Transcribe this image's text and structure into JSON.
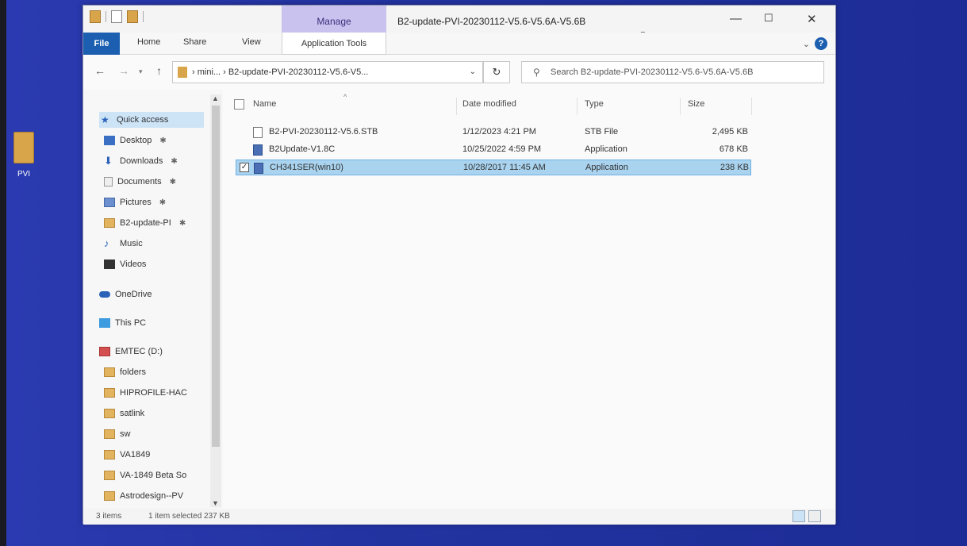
{
  "desktop": {
    "icon_label": "PVI"
  },
  "window": {
    "title": "B2-update-PVI-20230112-V5.6-V5.6A-V5.6B",
    "manage_tab": "Manage",
    "controls": {
      "minimize": "—",
      "maximize": "☐",
      "close": "✕"
    }
  },
  "ribbon": {
    "tabs": [
      "File",
      "Home",
      "Share",
      "View",
      "Application Tools"
    ],
    "help": "?"
  },
  "address_bar": {
    "path": "› mini... › B2-update-PVI-20230112-V5.6-V5...",
    "search_placeholder": "Search B2-update-PVI-20230112-V5.6-V5.6A-V5.6B"
  },
  "nav_pane": {
    "quick_access": "Quick access",
    "items": [
      {
        "label": "Desktop",
        "icon": "desktop-icon",
        "pinned": true
      },
      {
        "label": "Downloads",
        "icon": "download-icon",
        "pinned": true
      },
      {
        "label": "Documents",
        "icon": "document-icon",
        "pinned": true
      },
      {
        "label": "Pictures",
        "icon": "picture-icon",
        "pinned": true
      },
      {
        "label": "B2-update-PI",
        "icon": "folder-icon",
        "pinned": true
      },
      {
        "label": "Music",
        "icon": "music-icon",
        "pinned": false
      },
      {
        "label": "Videos",
        "icon": "video-icon",
        "pinned": false
      }
    ],
    "onedrive": "OneDrive",
    "this_pc": "This PC",
    "drive": "EMTEC (D:)",
    "drive_folders": [
      "folders",
      "HIPROFILE-HAC",
      "satlink",
      "sw",
      "VA1849",
      "VA-1849 Beta So",
      "Astrodesign--PV"
    ]
  },
  "columns": {
    "name": "Name",
    "date": "Date modified",
    "type": "Type",
    "size": "Size"
  },
  "files": [
    {
      "name": "B2-PVI-20230112-V5.6.STB",
      "date": "1/12/2023 4:21 PM",
      "type": "STB File",
      "size": "2,495 KB",
      "icon": "document-icon",
      "selected": false
    },
    {
      "name": "B2Update-V1.8C",
      "date": "10/25/2022 4:59 PM",
      "type": "Application",
      "size": "678 KB",
      "icon": "application-icon",
      "selected": false
    },
    {
      "name": "CH341SER(win10)",
      "date": "10/28/2017 11:45 AM",
      "type": "Application",
      "size": "238 KB",
      "icon": "application-icon",
      "selected": true
    }
  ],
  "status": {
    "items": "3 items",
    "selected": "1 item selected  237 KB"
  }
}
